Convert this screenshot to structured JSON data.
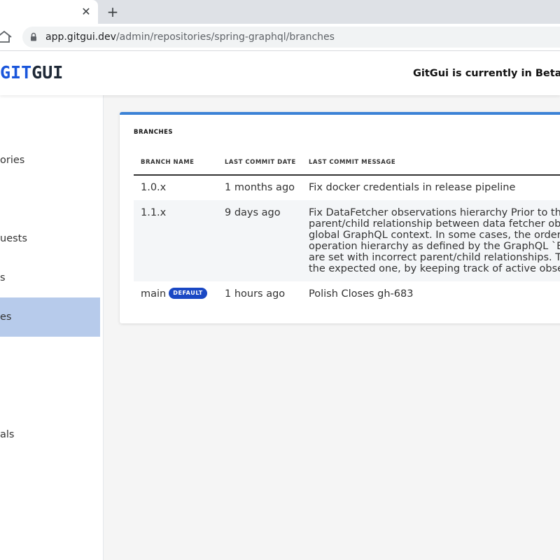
{
  "browser": {
    "url_host": "app.gitgui.dev",
    "url_path": "/admin/repositories/spring-graphql/branches",
    "tab_close": "✕",
    "new_tab": "+"
  },
  "header": {
    "logo_git": "GIT",
    "logo_gui": "GUI",
    "beta_text": "GitGui is currently in Beta"
  },
  "sidebar": {
    "items": [
      {
        "label": "ories"
      },
      {
        "label": "uests"
      },
      {
        "label": "s"
      },
      {
        "label": "es",
        "active": true
      },
      {
        "label": "als"
      }
    ]
  },
  "branches": {
    "title": "BRANCHES",
    "columns": [
      "BRANCH NAME",
      "LAST COMMIT DATE",
      "LAST COMMIT MESSAGE"
    ],
    "rows": [
      {
        "name": "1.0.x",
        "date": "1 months ago",
        "message": [
          "Fix docker credentials in release pipeline"
        ]
      },
      {
        "name": "1.1.x",
        "date": "9 days ago",
        "message": [
          "Fix DataFetcher observations hierarchy Prior to this co",
          "parent/child relationship between data fetcher observ",
          "global GraphQL context. In some cases, the order of ex",
          "operation hierarchy as defined by the GraphQL `Execu",
          "are set with incorrect parent/child relationships. This c",
          "the expected one, by keeping track of active observatio"
        ]
      },
      {
        "name": "main",
        "badge": "DEFAULT",
        "date": "1 hours ago",
        "message": [
          "Polish Closes gh-683"
        ]
      }
    ]
  },
  "colors": {
    "accent": "#3b82d6",
    "logo_blue": "#1a56db",
    "active_sidebar": "#b7cbeb",
    "badge": "#1a48c4"
  }
}
